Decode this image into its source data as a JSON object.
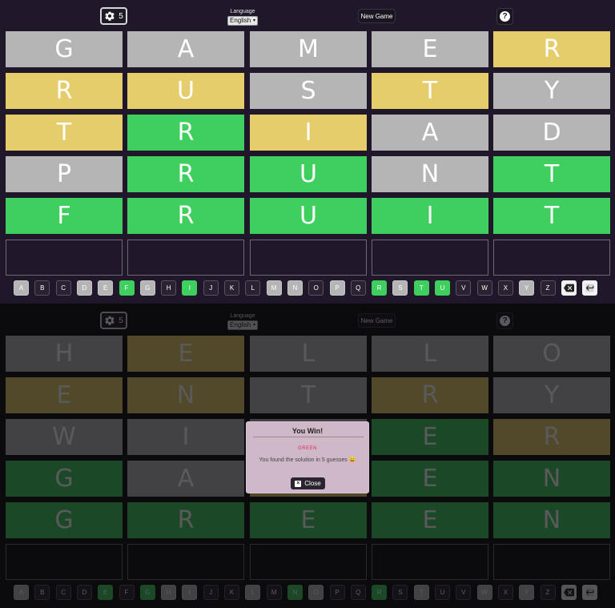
{
  "colors": {
    "top_bg": "#20172a",
    "bottom_bg": "#0b0a0d",
    "gray": "#b5b5b5",
    "yellow": "#e6cd6c",
    "green": "#3ecf5e",
    "modal_bg": "#cfb9c9",
    "solution_text": "#e0245e"
  },
  "top": {
    "header": {
      "settings_count": "5",
      "language_label": "Language",
      "language_value": "English",
      "new_game": "New Game",
      "help_icon": "question-circle-icon"
    },
    "board": [
      [
        {
          "l": "G",
          "s": "gray"
        },
        {
          "l": "A",
          "s": "gray"
        },
        {
          "l": "M",
          "s": "gray"
        },
        {
          "l": "E",
          "s": "gray"
        },
        {
          "l": "R",
          "s": "yellow"
        }
      ],
      [
        {
          "l": "R",
          "s": "yellow"
        },
        {
          "l": "U",
          "s": "yellow"
        },
        {
          "l": "S",
          "s": "gray"
        },
        {
          "l": "T",
          "s": "yellow"
        },
        {
          "l": "Y",
          "s": "gray"
        }
      ],
      [
        {
          "l": "T",
          "s": "yellow"
        },
        {
          "l": "R",
          "s": "green"
        },
        {
          "l": "I",
          "s": "yellow"
        },
        {
          "l": "A",
          "s": "gray"
        },
        {
          "l": "D",
          "s": "gray"
        }
      ],
      [
        {
          "l": "P",
          "s": "gray"
        },
        {
          "l": "R",
          "s": "green"
        },
        {
          "l": "U",
          "s": "green"
        },
        {
          "l": "N",
          "s": "gray"
        },
        {
          "l": "T",
          "s": "green"
        }
      ],
      [
        {
          "l": "F",
          "s": "green"
        },
        {
          "l": "R",
          "s": "green"
        },
        {
          "l": "U",
          "s": "green"
        },
        {
          "l": "I",
          "s": "green"
        },
        {
          "l": "T",
          "s": "green"
        }
      ],
      [
        {
          "l": "",
          "s": "empty"
        },
        {
          "l": "",
          "s": "empty"
        },
        {
          "l": "",
          "s": "empty"
        },
        {
          "l": "",
          "s": "empty"
        },
        {
          "l": "",
          "s": "empty"
        }
      ]
    ],
    "keyboard": [
      {
        "k": "A",
        "s": "gray"
      },
      {
        "k": "B",
        "s": "none"
      },
      {
        "k": "C",
        "s": "none"
      },
      {
        "k": "D",
        "s": "gray"
      },
      {
        "k": "E",
        "s": "gray"
      },
      {
        "k": "F",
        "s": "green"
      },
      {
        "k": "G",
        "s": "gray"
      },
      {
        "k": "H",
        "s": "none"
      },
      {
        "k": "I",
        "s": "green"
      },
      {
        "k": "J",
        "s": "none"
      },
      {
        "k": "K",
        "s": "none"
      },
      {
        "k": "L",
        "s": "none"
      },
      {
        "k": "M",
        "s": "gray"
      },
      {
        "k": "N",
        "s": "gray"
      },
      {
        "k": "O",
        "s": "none"
      },
      {
        "k": "P",
        "s": "gray"
      },
      {
        "k": "Q",
        "s": "none"
      },
      {
        "k": "R",
        "s": "green"
      },
      {
        "k": "S",
        "s": "gray"
      },
      {
        "k": "T",
        "s": "green"
      },
      {
        "k": "U",
        "s": "green"
      },
      {
        "k": "V",
        "s": "none"
      },
      {
        "k": "W",
        "s": "none"
      },
      {
        "k": "X",
        "s": "none"
      },
      {
        "k": "Y",
        "s": "gray"
      },
      {
        "k": "Z",
        "s": "none"
      },
      {
        "k": "backspace-icon",
        "s": "icon"
      },
      {
        "k": "enter-icon",
        "s": "icon"
      }
    ]
  },
  "bottom": {
    "header": {
      "settings_count": "5",
      "language_label": "Language",
      "language_value": "English",
      "new_game": "New Game",
      "help_icon": "question-circle-icon"
    },
    "board": [
      [
        {
          "l": "H",
          "s": "gray"
        },
        {
          "l": "E",
          "s": "yellow"
        },
        {
          "l": "L",
          "s": "gray"
        },
        {
          "l": "L",
          "s": "gray"
        },
        {
          "l": "O",
          "s": "gray"
        }
      ],
      [
        {
          "l": "E",
          "s": "yellow"
        },
        {
          "l": "N",
          "s": "yellow"
        },
        {
          "l": "T",
          "s": "gray"
        },
        {
          "l": "R",
          "s": "yellow"
        },
        {
          "l": "Y",
          "s": "gray"
        }
      ],
      [
        {
          "l": "W",
          "s": "gray"
        },
        {
          "l": "I",
          "s": "gray"
        },
        {
          "l": "",
          "s": "gray"
        },
        {
          "l": "E",
          "s": "green"
        },
        {
          "l": "R",
          "s": "yellow"
        }
      ],
      [
        {
          "l": "G",
          "s": "green"
        },
        {
          "l": "A",
          "s": "gray"
        },
        {
          "l": "",
          "s": "yellow"
        },
        {
          "l": "E",
          "s": "green"
        },
        {
          "l": "N",
          "s": "green"
        }
      ],
      [
        {
          "l": "G",
          "s": "green"
        },
        {
          "l": "R",
          "s": "green"
        },
        {
          "l": "E",
          "s": "green"
        },
        {
          "l": "E",
          "s": "green"
        },
        {
          "l": "N",
          "s": "green"
        }
      ],
      [
        {
          "l": "",
          "s": "empty"
        },
        {
          "l": "",
          "s": "empty"
        },
        {
          "l": "",
          "s": "empty"
        },
        {
          "l": "",
          "s": "empty"
        },
        {
          "l": "",
          "s": "empty"
        }
      ]
    ],
    "keyboard": [
      {
        "k": "A",
        "s": "gray"
      },
      {
        "k": "B",
        "s": "none"
      },
      {
        "k": "C",
        "s": "none"
      },
      {
        "k": "D",
        "s": "none"
      },
      {
        "k": "E",
        "s": "green"
      },
      {
        "k": "F",
        "s": "none"
      },
      {
        "k": "G",
        "s": "green"
      },
      {
        "k": "H",
        "s": "gray"
      },
      {
        "k": "I",
        "s": "gray"
      },
      {
        "k": "J",
        "s": "none"
      },
      {
        "k": "K",
        "s": "none"
      },
      {
        "k": "L",
        "s": "gray"
      },
      {
        "k": "M",
        "s": "none"
      },
      {
        "k": "N",
        "s": "green"
      },
      {
        "k": "O",
        "s": "gray"
      },
      {
        "k": "P",
        "s": "none"
      },
      {
        "k": "Q",
        "s": "none"
      },
      {
        "k": "R",
        "s": "green"
      },
      {
        "k": "S",
        "s": "none"
      },
      {
        "k": "T",
        "s": "gray"
      },
      {
        "k": "U",
        "s": "none"
      },
      {
        "k": "V",
        "s": "none"
      },
      {
        "k": "W",
        "s": "gray"
      },
      {
        "k": "X",
        "s": "none"
      },
      {
        "k": "Y",
        "s": "gray"
      },
      {
        "k": "Z",
        "s": "none"
      },
      {
        "k": "backspace-icon",
        "s": "icon"
      },
      {
        "k": "enter-icon",
        "s": "icon"
      }
    ]
  },
  "modal": {
    "title": "You Win!",
    "solution": "GREEN",
    "message": "You found the solution in 5 guesses 😀",
    "close_label": "Close",
    "close_icon": "close-icon"
  }
}
